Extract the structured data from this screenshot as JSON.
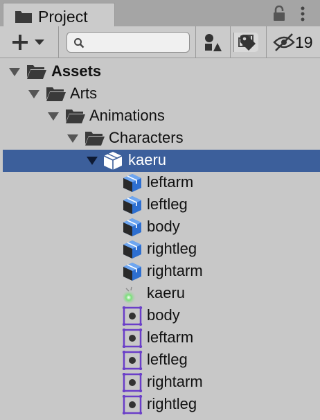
{
  "window": {
    "tab_title": "Project",
    "icons": [
      "folder-icon",
      "lock-icon",
      "kebab-menu-icon"
    ]
  },
  "toolbar": {
    "add_icon": "plus-icon",
    "search": {
      "value": "",
      "placeholder": ""
    },
    "hidden_count": "19",
    "buttons": [
      "add-button",
      "search-mode-button",
      "filter-by-type-button",
      "filter-by-label-button",
      "toggle-hidden-packages-button"
    ]
  },
  "tree": {
    "items": [
      {
        "label": "Assets",
        "icon": "folder-open-icon",
        "expanded": true,
        "bold": true
      },
      {
        "label": "Arts",
        "icon": "folder-open-icon",
        "expanded": true
      },
      {
        "label": "Animations",
        "icon": "folder-open-icon",
        "expanded": true
      },
      {
        "label": "Characters",
        "icon": "folder-open-icon",
        "expanded": true
      },
      {
        "label": "kaeru",
        "icon": "model-prefab-icon",
        "expanded": true,
        "selected": true
      },
      {
        "label": "leftarm",
        "icon": "mesh-icon"
      },
      {
        "label": "leftleg",
        "icon": "mesh-icon"
      },
      {
        "label": "body",
        "icon": "mesh-icon"
      },
      {
        "label": "rightleg",
        "icon": "mesh-icon"
      },
      {
        "label": "rightarm",
        "icon": "mesh-icon"
      },
      {
        "label": "kaeru",
        "icon": "material-icon"
      },
      {
        "label": "body",
        "icon": "avatar-icon"
      },
      {
        "label": "leftarm",
        "icon": "avatar-icon"
      },
      {
        "label": "leftleg",
        "icon": "avatar-icon"
      },
      {
        "label": "rightarm",
        "icon": "avatar-icon"
      },
      {
        "label": "rightleg",
        "icon": "avatar-icon"
      }
    ]
  },
  "colors": {
    "selection": "#3c5f9b",
    "background": "#c8c8c8",
    "tabbar": "#a5a5a5",
    "mesh_blue": "#2d6fd1",
    "avatar_purple": "#6a3ec8"
  }
}
